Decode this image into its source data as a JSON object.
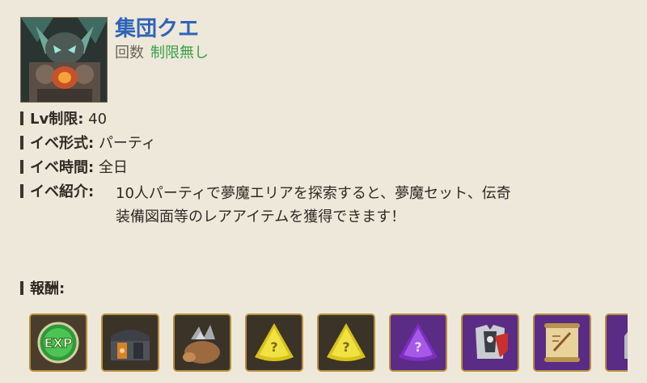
{
  "event": {
    "title": "集団クエ",
    "count_label": "回数",
    "count_value": "制限無し",
    "value_color": "#3aa047",
    "title_color": "#2f63b8"
  },
  "info": [
    {
      "key": "Lv制限:",
      "value": "40"
    },
    {
      "key": "イベ形式:",
      "value": "パーティ"
    },
    {
      "key": "イベ時間:",
      "value": "全日"
    },
    {
      "key": "イベ紹介:",
      "value": "10人パーティで夢魔エリアを探索すると、夢魔セット、伝奇",
      "value2": "装備図面等のレアアイテムを獲得できます！"
    }
  ],
  "rewards_label": "報酬:",
  "rewards": [
    {
      "icon": "exp-orb-icon",
      "text": "EXP"
    },
    {
      "icon": "treasure-chest-icon"
    },
    {
      "icon": "ore-sack-icon"
    },
    {
      "icon": "yellow-mystery-gem-icon",
      "text": "?"
    },
    {
      "icon": "yellow-mystery-gem-icon",
      "text": "?"
    },
    {
      "icon": "purple-mystery-gem-icon",
      "text": "?"
    },
    {
      "icon": "armor-set-icon"
    },
    {
      "icon": "blueprint-scroll-icon"
    },
    {
      "icon": "helmet-icon"
    }
  ]
}
